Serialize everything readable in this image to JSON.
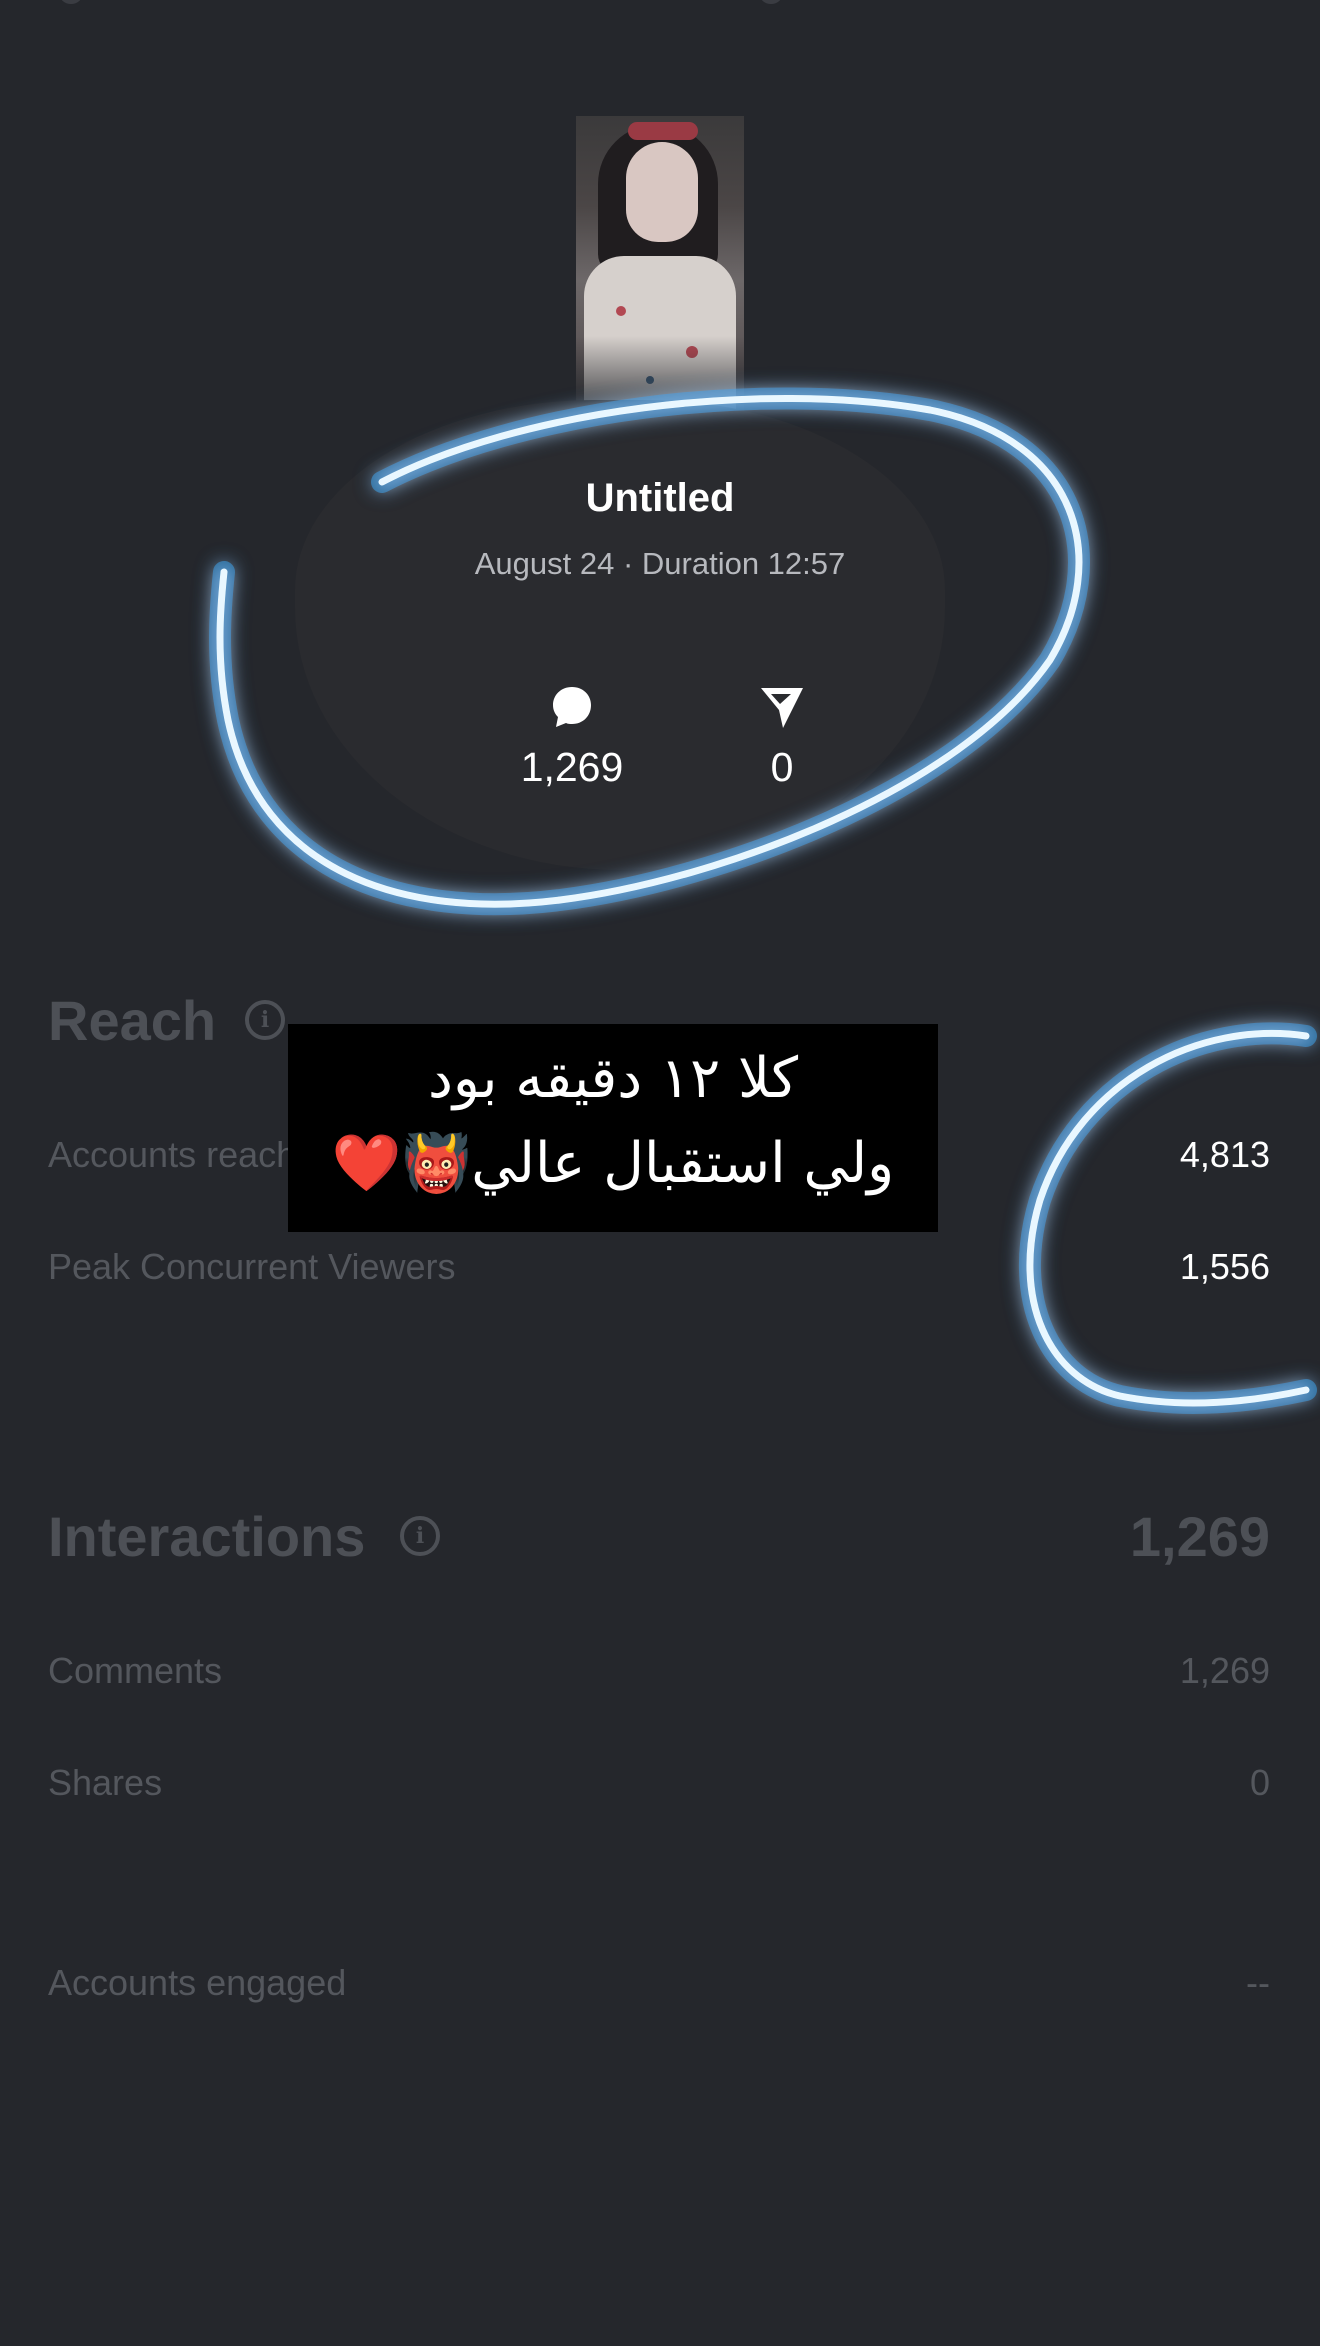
{
  "stream": {
    "title": "Untitled",
    "subtitle": "August 24 · Duration 12:57",
    "comments_count": "1,269",
    "shares_count": "0"
  },
  "reach": {
    "title": "Reach",
    "rows": [
      {
        "label": "Accounts reached",
        "value": "4,813"
      },
      {
        "label": "Peak Concurrent Viewers",
        "value": "1,556"
      }
    ]
  },
  "interactions": {
    "title": "Interactions",
    "total": "1,269",
    "rows": [
      {
        "label": "Comments",
        "value": "1,269"
      },
      {
        "label": "Shares",
        "value": "0"
      }
    ]
  },
  "engagement": {
    "label": "Accounts engaged",
    "value": "--"
  },
  "overlay": {
    "line1": "كلا ١٢ دقيقه بود",
    "line2": "ولي استقبال عالي👹❤️"
  },
  "colors": {
    "background": "#25272c",
    "highlight_stroke": "#4fb3f0"
  },
  "icons": {
    "comment": "comment-bubble-icon",
    "share": "paper-plane-icon",
    "info": "info-icon"
  }
}
